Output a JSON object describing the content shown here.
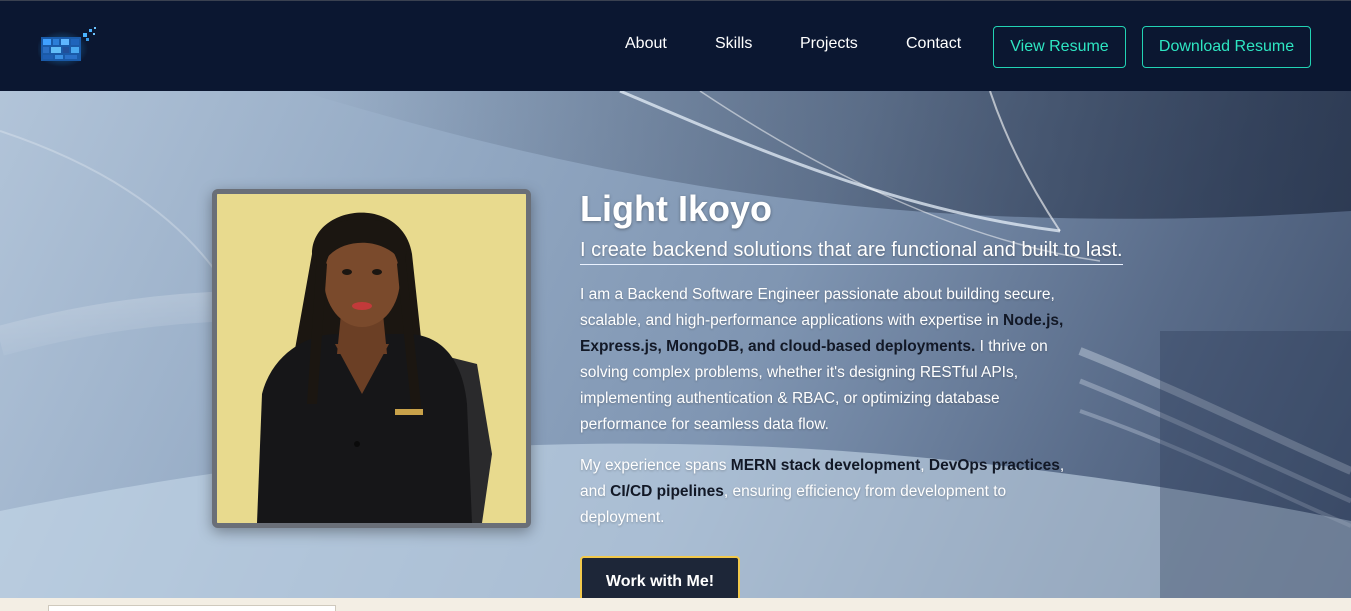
{
  "nav": {
    "logo_icon": "pixel-logo",
    "links": [
      "About",
      "Skills",
      "Projects",
      "Contact"
    ],
    "view_resume": "View Resume",
    "download_resume": "Download Resume",
    "accent_color": "#22d3b4",
    "bg_color": "#0b1731"
  },
  "hero": {
    "name": "Light Ikoyo",
    "tagline": "I create backend solutions that are functional and built to last.",
    "bio": {
      "p1_a": "I am a Backend Software Engineer passionate about building secure, scalable, and high-performance applications with expertise in ",
      "p1_b": "Node.js, Express.js, MongoDB, and cloud-based deployments.",
      "p1_c": " I thrive on solving complex problems, whether it's designing RESTful APIs, implementing authentication & RBAC, or optimizing database performance for seamless data flow.",
      "p2_a": "My experience spans ",
      "p2_b": "MERN stack development",
      "p2_c": ", ",
      "p2_d": "DevOps practices",
      "p2_e": ", and ",
      "p2_f": "CI/CD pipelines",
      "p2_g": ", ensuring efficiency from development to deployment."
    },
    "cta": "Work with Me!",
    "cta_border_color": "#f2c94c"
  }
}
